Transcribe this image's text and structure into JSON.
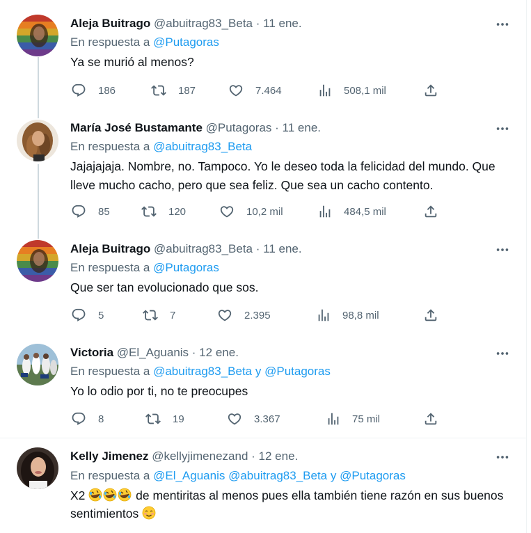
{
  "tweets": [
    {
      "name": "Aleja Buitrago",
      "handle": "@abuitrag83_Beta",
      "dot": "·",
      "date": "11 ene.",
      "reply_prefix": "En respuesta a",
      "mentions": [
        "@Putagoras"
      ],
      "text": "Ya se murió al menos?",
      "stats": {
        "replies": "186",
        "retweets": "187",
        "likes": "7.464",
        "views": "508,1 mil"
      }
    },
    {
      "name": "María José Bustamante",
      "handle": "@Putagoras",
      "dot": "·",
      "date": "11 ene.",
      "reply_prefix": "En respuesta a",
      "mentions": [
        "@abuitrag83_Beta"
      ],
      "text": "Jajajajaja.  Nombre, no. Tampoco. Yo le deseo toda la felicidad del mundo. Que lleve mucho cacho, pero que sea feliz. Que sea un cacho contento.",
      "stats": {
        "replies": "85",
        "retweets": "120",
        "likes": "10,2 mil",
        "views": "484,5 mil"
      }
    },
    {
      "name": "Aleja Buitrago",
      "handle": "@abuitrag83_Beta",
      "dot": "·",
      "date": "11 ene.",
      "reply_prefix": "En respuesta a",
      "mentions": [
        "@Putagoras"
      ],
      "text": "Que ser tan evolucionado que sos.",
      "stats": {
        "replies": "5",
        "retweets": "7",
        "likes": "2.395",
        "views": "98,8 mil"
      }
    },
    {
      "name": "Victoria",
      "handle": "@El_Aguanis",
      "dot": "·",
      "date": "12 ene.",
      "reply_prefix": "En respuesta a",
      "mentions": [
        "@abuitrag83_Beta",
        "@Putagoras"
      ],
      "mention_joiner": "y",
      "text": "Yo lo odio por ti, no te preocupes",
      "stats": {
        "replies": "8",
        "retweets": "19",
        "likes": "3.367",
        "views": "75 mil"
      }
    },
    {
      "name": "Kelly Jimenez",
      "handle": "@kellyjimenezand",
      "dot": "·",
      "date": "12 ene.",
      "reply_prefix": "En respuesta a",
      "mentions": [
        "@El_Aguanis",
        "@abuitrag83_Beta",
        "@Putagoras"
      ],
      "mention_joiner": "y",
      "text_before": "X2",
      "text_emojis": [
        "🤣",
        "🤣",
        "🤣"
      ],
      "text_after": "de mentiritas al menos pues ella también tiene razón en sus buenos sentimientos",
      "text_end_emoji": "😊"
    }
  ],
  "icons": {
    "reply": "reply-icon",
    "retweet": "retweet-icon",
    "like": "like-icon",
    "views": "views-icon",
    "share": "share-icon",
    "more": "more-icon"
  },
  "colors": {
    "link": "#1d9bf0",
    "secondary_text": "#536471",
    "primary_text": "#0f1419",
    "thread_line": "#cfd9de"
  }
}
